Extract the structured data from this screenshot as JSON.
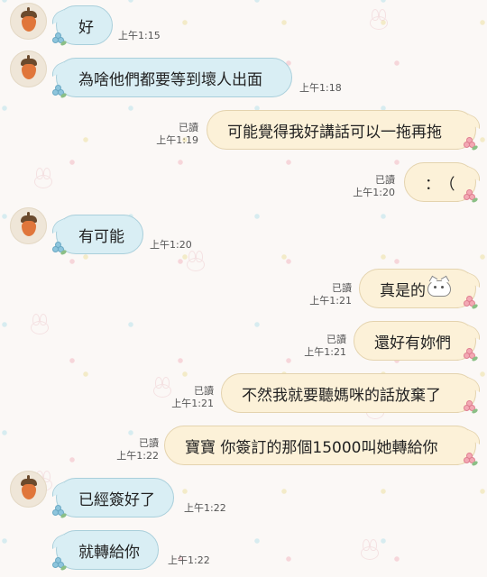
{
  "chat": {
    "messages": [
      {
        "side": "received",
        "text": "好",
        "time": "上午1:15"
      },
      {
        "side": "received",
        "text": "為啥他們都要等到壞人出面",
        "time": "上午1:18"
      },
      {
        "side": "sent",
        "text": "可能覺得我好講話可以一拖再拖",
        "read": "已讀",
        "time": "上午1:19"
      },
      {
        "side": "sent",
        "text": "：（",
        "read": "已讀",
        "time": "上午1:20"
      },
      {
        "side": "received",
        "text": "有可能",
        "time": "上午1:20"
      },
      {
        "side": "sent",
        "text": "真是的",
        "read": "已讀",
        "time": "上午1:21",
        "emoji": "cat-face-emoji"
      },
      {
        "side": "sent",
        "text": "還好有妳們",
        "read": "已讀",
        "time": "上午1:21"
      },
      {
        "side": "sent",
        "text": "不然我就要聽媽咪的話放棄了",
        "read": "已讀",
        "time": "上午1:21"
      },
      {
        "side": "sent",
        "text": "寶寶 你簽訂的那個15000叫她轉給你",
        "read": "已讀",
        "time": "上午1:22"
      },
      {
        "side": "received",
        "text": "已經簽好了",
        "time": "上午1:22"
      },
      {
        "side": "received",
        "text": "就轉給你",
        "time": "上午1:22"
      }
    ]
  },
  "colors": {
    "received_bubble": "#d9eef4",
    "sent_bubble": "#fcf1d8",
    "background": "#fbf8f6"
  },
  "icons": {
    "avatar": "acorn-avatar-icon",
    "received_decoration": "blue-flower-icon",
    "sent_decoration": "pink-flower-icon"
  }
}
